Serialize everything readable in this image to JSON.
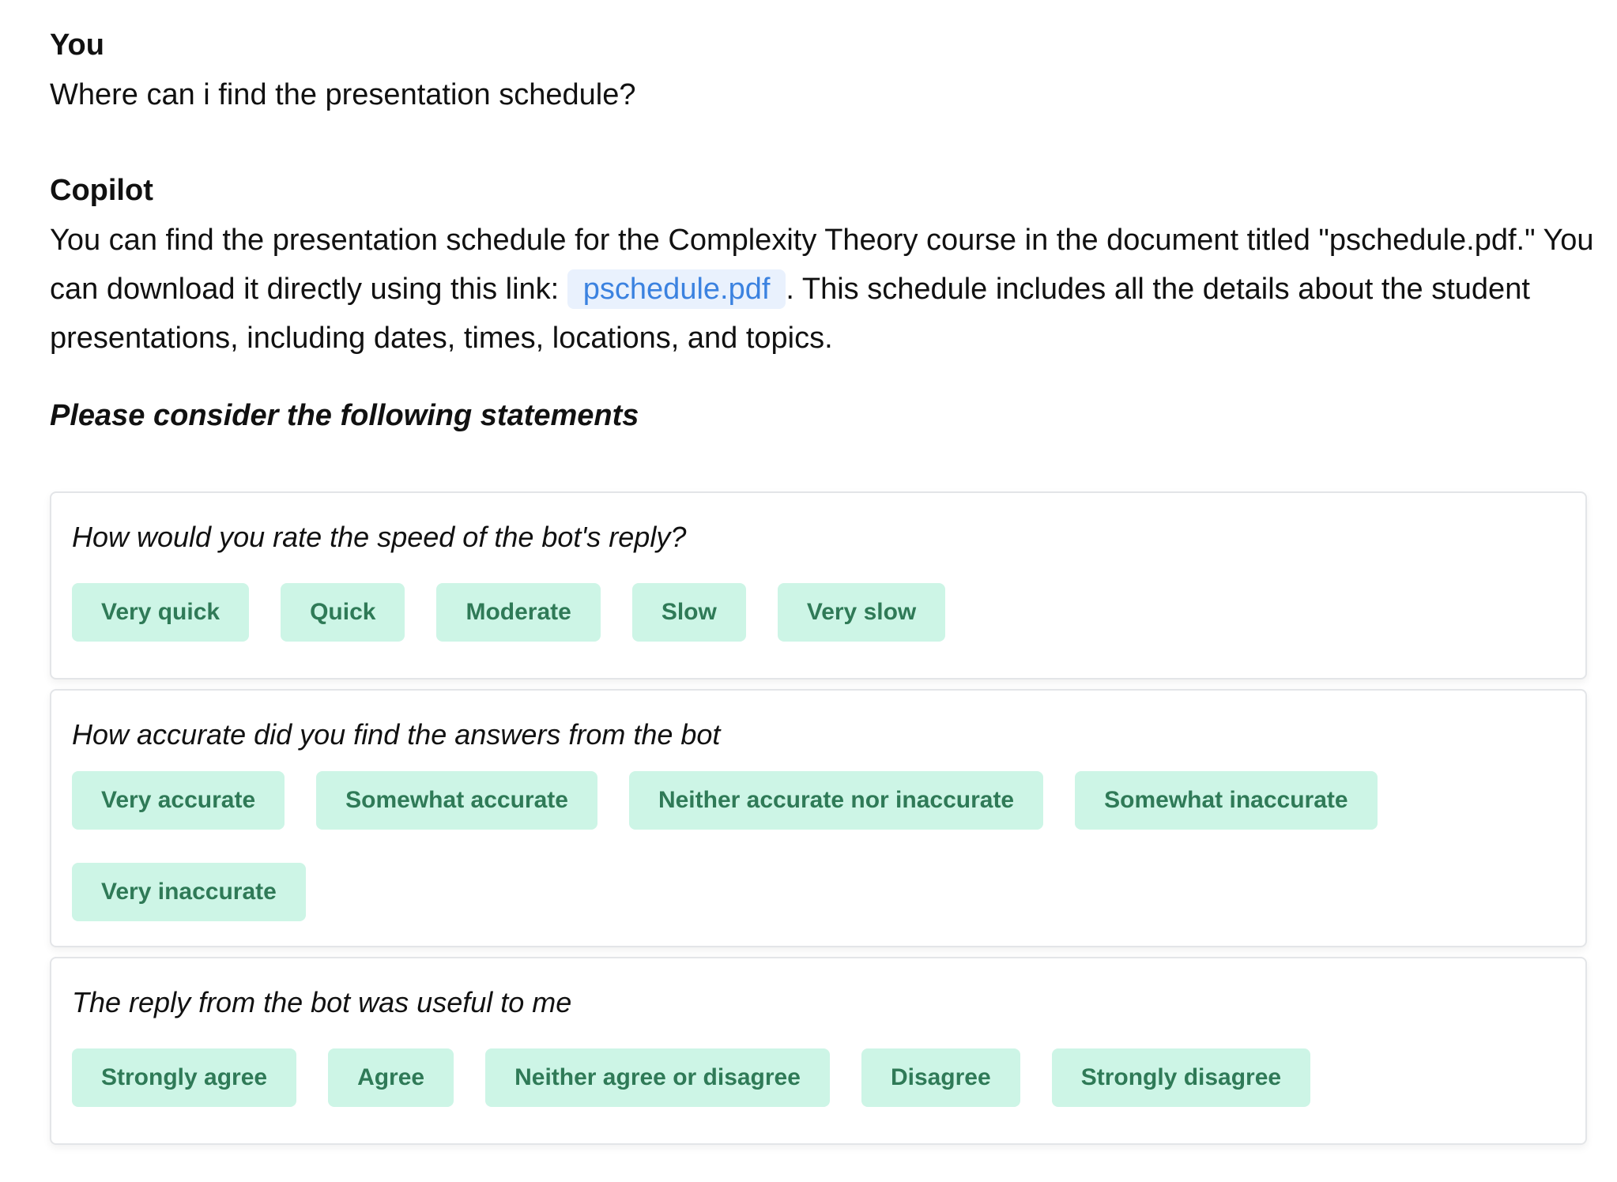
{
  "conversation": {
    "user_label": "You",
    "user_message": "Where can i find the presentation schedule?",
    "bot_label": "Copilot",
    "bot_message_before_link": "You can find the presentation schedule for the Complexity Theory course in the document titled \"pschedule.pdf.\" You can download it directly using this link: ",
    "link_text": "pschedule.pdf",
    "bot_message_after_link": ". This schedule includes all the details about the student presentations, including dates, times, locations, and topics."
  },
  "survey": {
    "heading": "Please consider the following statements",
    "questions": [
      {
        "text": "How would you rate the speed of the bot's reply?",
        "options": [
          "Very quick",
          "Quick",
          "Moderate",
          "Slow",
          "Very slow"
        ]
      },
      {
        "text": "How accurate did you find the answers from the bot",
        "options": [
          "Very accurate",
          "Somewhat accurate",
          "Neither accurate nor inaccurate",
          "Somewhat inaccurate",
          "Very inaccurate"
        ]
      },
      {
        "text": "The reply from the bot was useful to me",
        "options": [
          "Strongly agree",
          "Agree",
          "Neither agree or disagree",
          "Disagree",
          "Strongly disagree"
        ]
      }
    ]
  },
  "colors": {
    "option_bg": "#cdf5e6",
    "option_text": "#2f7a57",
    "link_bg": "#e9f1fd",
    "link_text": "#3b82e0"
  }
}
